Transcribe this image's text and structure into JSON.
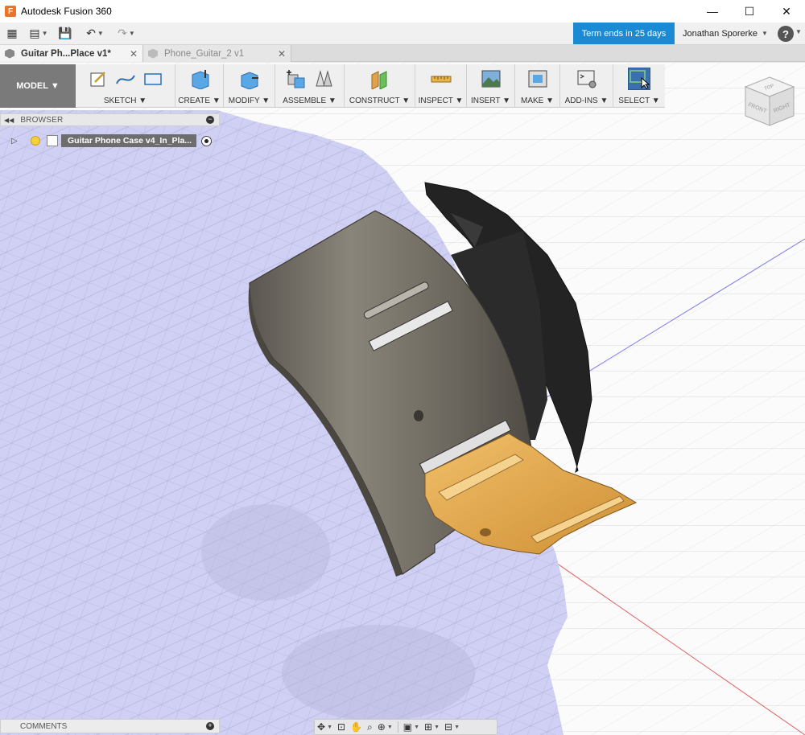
{
  "window": {
    "app_icon": "F",
    "title": "Autodesk Fusion 360",
    "minimize_glyph": "—",
    "maximize_glyph": "☐",
    "close_glyph": "✕"
  },
  "quick_toolbar": {
    "term_notice": "Term ends in 25 days",
    "user_name": "Jonathan Sporerke",
    "user_caret": "▼",
    "help_glyph": "?",
    "help_caret": "▼"
  },
  "tabs": [
    {
      "label": "Guitar Ph...Place v1*",
      "active": true
    },
    {
      "label": "Phone_Guitar_2 v1",
      "active": false
    }
  ],
  "tab_close_glyph": "✕",
  "workspace": {
    "label": "MODEL ▼"
  },
  "ribbon": [
    {
      "label": "SKETCH ▼"
    },
    {
      "label": "CREATE ▼"
    },
    {
      "label": "MODIFY ▼"
    },
    {
      "label": "ASSEMBLE ▼"
    },
    {
      "label": "CONSTRUCT ▼"
    },
    {
      "label": "INSPECT ▼"
    },
    {
      "label": "INSERT ▼"
    },
    {
      "label": "MAKE ▼"
    },
    {
      "label": "ADD-INS ▼"
    },
    {
      "label": "SELECT ▼"
    }
  ],
  "browser": {
    "collapse_glyph": "◀◀",
    "title": "BROWSER",
    "minimize_glyph": "−",
    "root_node": "Guitar Phone Case v4_In_Pla...",
    "expander_glyph": "▷"
  },
  "viewcube": {
    "top": "TOP",
    "front": "FRONT",
    "right": "RIGHT"
  },
  "comments": {
    "title": "COMMENTS",
    "add_glyph": "+"
  },
  "icons": {
    "caret": "▼",
    "grid": "▦",
    "file": "▤",
    "save": "💾",
    "undo": "↶",
    "redo": "↷",
    "orbit": "✥",
    "look": "⊡",
    "pan": "✋",
    "zoom": "⌕",
    "fit": "⊕",
    "display": "▣",
    "grid_settings": "⊞",
    "viewports": "⊟"
  },
  "colors": {
    "term_banner": "#1a8ad4",
    "workspace_button": "#7a7a7a",
    "mesh_fill": "#cfd0f3",
    "case_body": "#6f6a60",
    "cradle": "#e3a64a",
    "backplate": "#232323",
    "axis_red": "#e06060",
    "axis_blue": "#7b7bea"
  }
}
